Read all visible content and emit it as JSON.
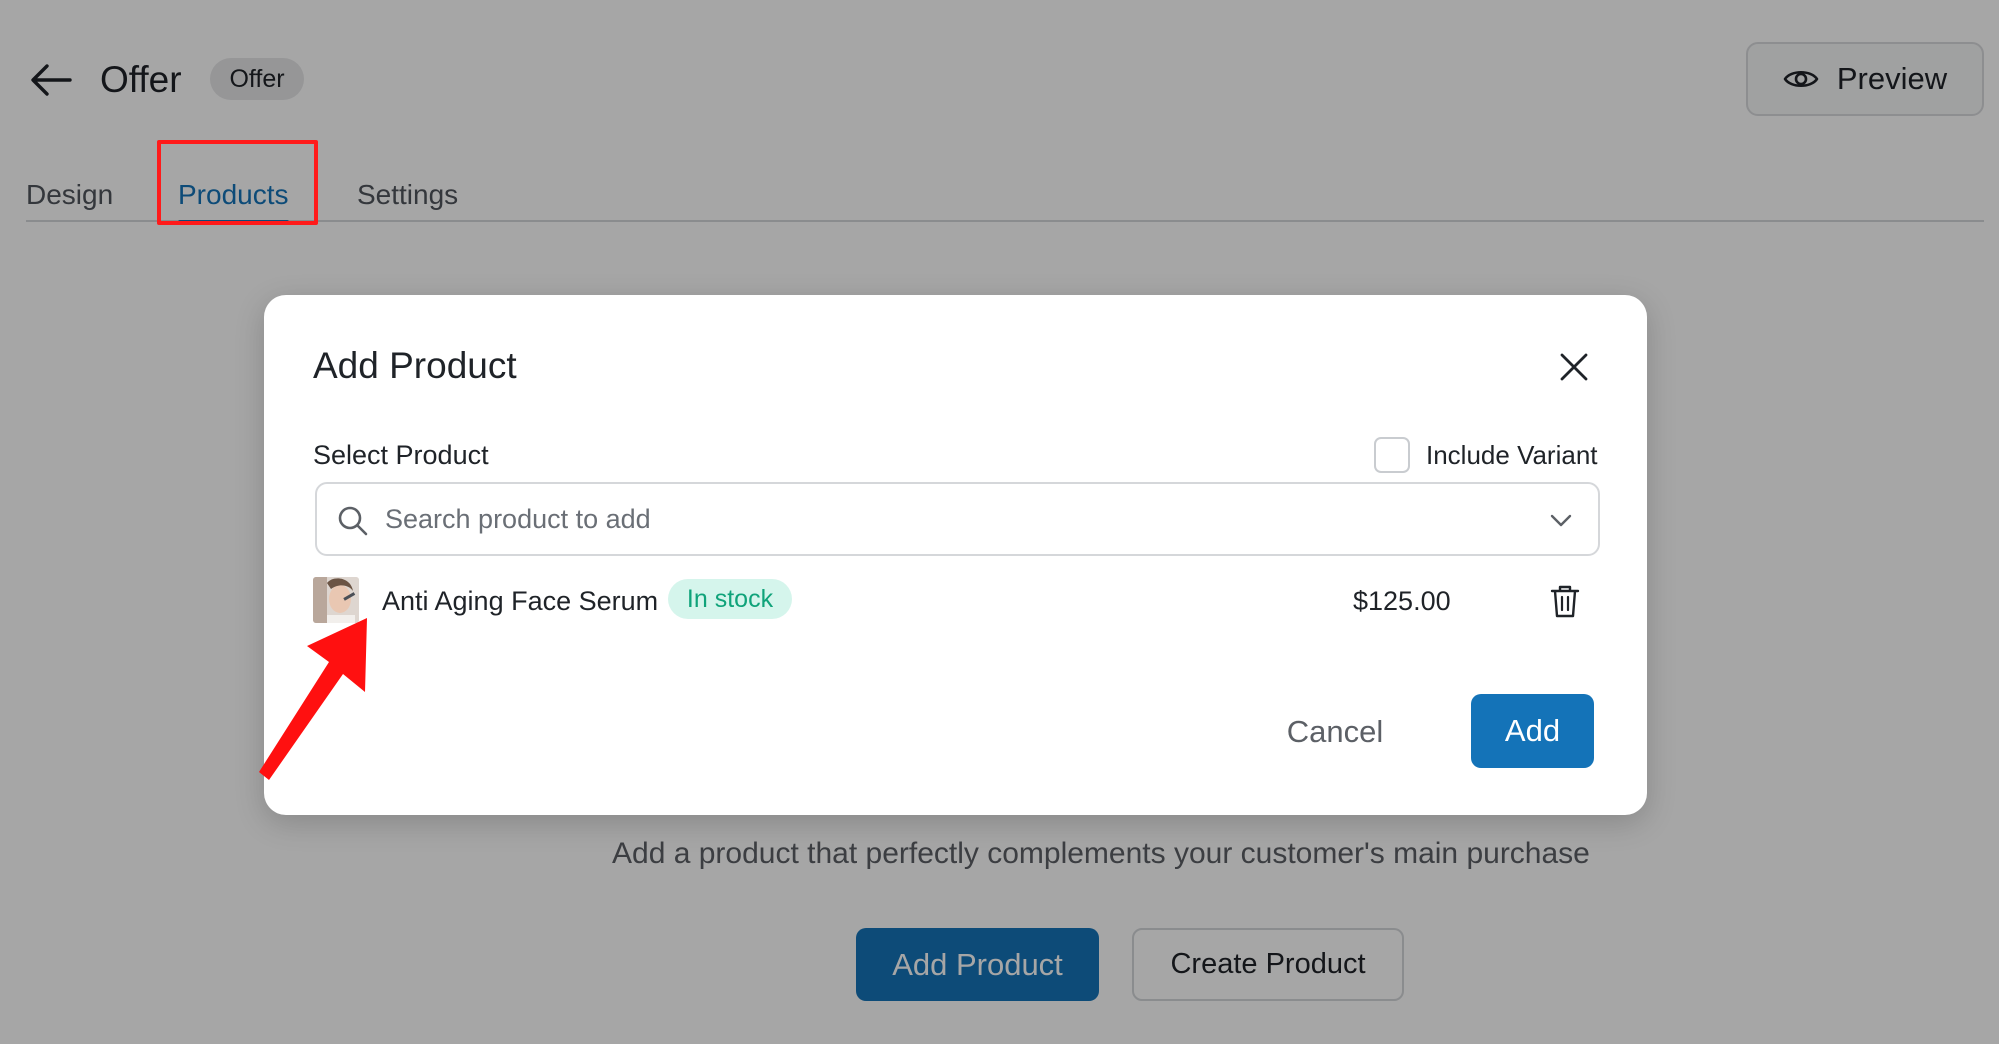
{
  "header": {
    "title": "Offer",
    "type_badge": "Offer",
    "preview_label": "Preview"
  },
  "tabs": [
    {
      "label": "Design",
      "active": false
    },
    {
      "label": "Products",
      "active": true
    },
    {
      "label": "Settings",
      "active": false
    }
  ],
  "empty_state": {
    "text": "Add a product that perfectly complements your customer's main purchase",
    "add_product_label": "Add Product",
    "create_product_label": "Create Product"
  },
  "modal": {
    "title": "Add Product",
    "select_label": "Select Product",
    "include_variant_label": "Include Variant",
    "include_variant_checked": false,
    "search_placeholder": "Search product to add",
    "products": [
      {
        "name": "Anti Aging Face Serum",
        "stock_status": "In stock",
        "price": "$125.00"
      }
    ],
    "cancel_label": "Cancel",
    "add_label": "Add"
  },
  "icons": {
    "back": "arrow-left-icon",
    "preview": "eye-icon",
    "close": "close-icon",
    "search": "search-icon",
    "dropdown": "chevron-down-icon",
    "delete": "trash-icon"
  },
  "colors": {
    "primary": "#1473b8",
    "stock_badge_bg": "#d5f5ec",
    "stock_badge_text": "#10a37a",
    "highlight": "#ff1a1a"
  }
}
